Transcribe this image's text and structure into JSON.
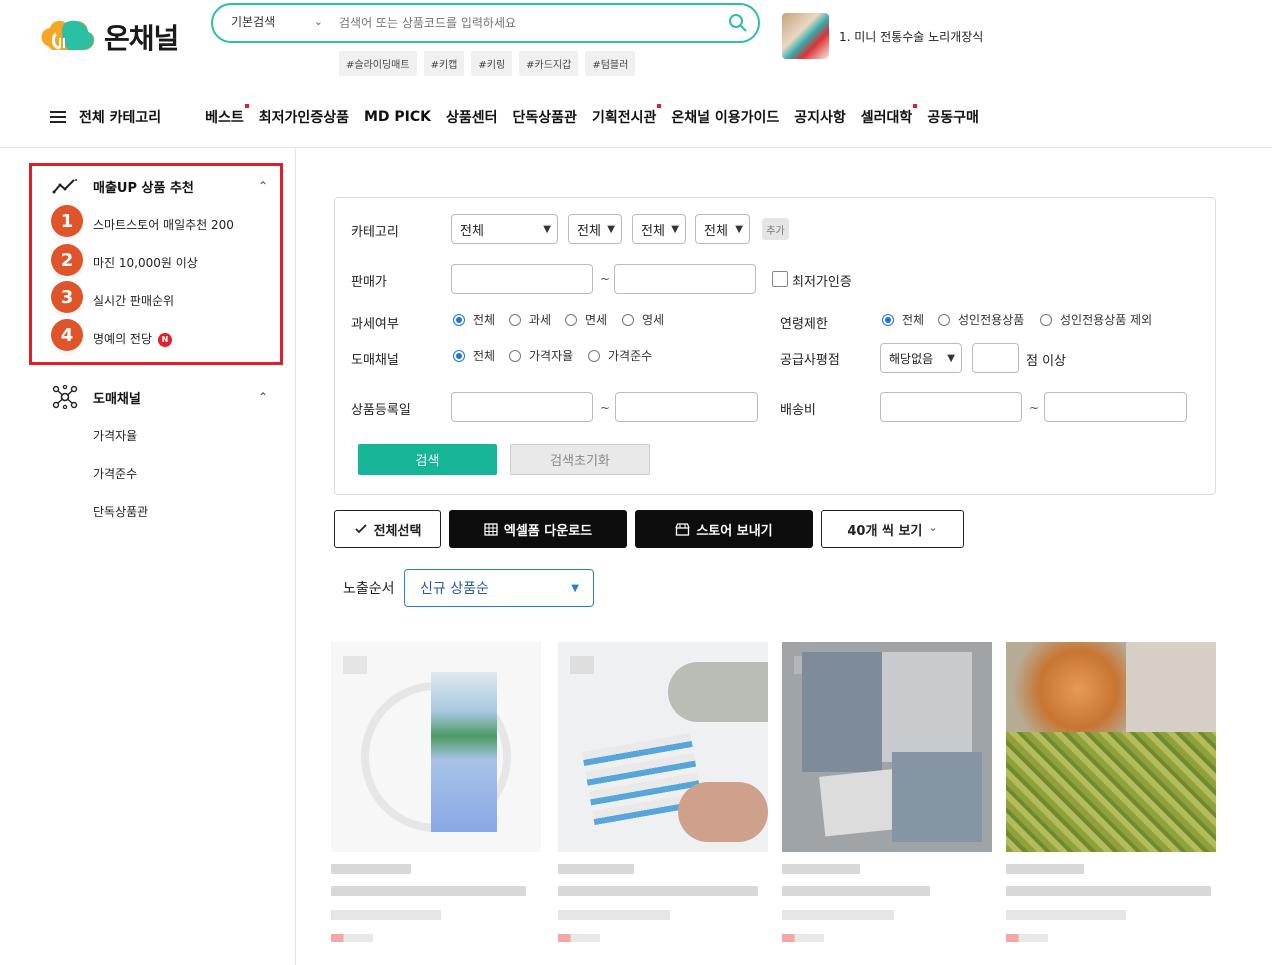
{
  "header": {
    "logo_text": "온채널",
    "search": {
      "scope": "기본검색",
      "placeholder": "검색어 또는 상품코드를 입력하세요"
    },
    "tags": [
      "#슬라이딩매트",
      "#키캡",
      "#키링",
      "#카드지갑",
      "#텀블러"
    ],
    "promo": {
      "text": "1. 미니 전통수술 노리개장식"
    }
  },
  "nav": {
    "all_label": "전체 카테고리",
    "items": [
      {
        "label": "베스트",
        "dot": true
      },
      {
        "label": "최저가인증상품",
        "dot": false
      },
      {
        "label": "MD PICK",
        "dot": false
      },
      {
        "label": "상품센터",
        "dot": false
      },
      {
        "label": "단독상품관",
        "dot": false
      },
      {
        "label": "기획전시관",
        "dot": true
      },
      {
        "label": "온채널 이용가이드",
        "dot": false
      },
      {
        "label": "공지사항",
        "dot": false
      },
      {
        "label": "셀러대학",
        "dot": true
      },
      {
        "label": "공동구매",
        "dot": false
      }
    ]
  },
  "sidebar": {
    "section1": {
      "title": "매출UP 상품 추천",
      "items": [
        {
          "num": "1",
          "label": "스마트스토어 매일추천 200"
        },
        {
          "num": "2",
          "label": "마진 10,000원 이상"
        },
        {
          "num": "3",
          "label": "실시간 판매순위"
        },
        {
          "num": "4",
          "label": "명예의 전당",
          "badge": "N"
        }
      ]
    },
    "section2": {
      "title": "도매채널",
      "items": [
        "가격자율",
        "가격준수",
        "단독상품관"
      ]
    }
  },
  "filter": {
    "category_label": "카테고리",
    "category_selects": [
      "전체",
      "전체",
      "전체",
      "전체"
    ],
    "add_label": "추가",
    "price_label": "판매가",
    "tilde": "~",
    "lowest_price_label": "최저가인증",
    "tax_label": "과세여부",
    "tax_options": [
      "전체",
      "과세",
      "면세",
      "영세"
    ],
    "age_label": "연령제한",
    "age_options": [
      "전체",
      "성인전용상품",
      "성인전용상품 제외"
    ],
    "channel_label": "도매채널",
    "channel_options": [
      "전체",
      "가격자율",
      "가격준수"
    ],
    "supplier_label": "공급사평점",
    "supplier_select": "해당없음",
    "supplier_suffix": "점 이상",
    "regdate_label": "상품등록일",
    "shipping_label": "배송비",
    "search_btn": "검색",
    "reset_btn": "검색초기화"
  },
  "actions": {
    "select_all": "전체선택",
    "excel": "엑셀폼 다운로드",
    "store": "스토어 보내기",
    "per_page": "40개 씩 보기"
  },
  "sort": {
    "label": "노출순서",
    "value": "신규 상품순"
  },
  "colors": {
    "accent": "#2bbfa4",
    "highlight": "#e11d2a",
    "badge": "#e0542a"
  }
}
